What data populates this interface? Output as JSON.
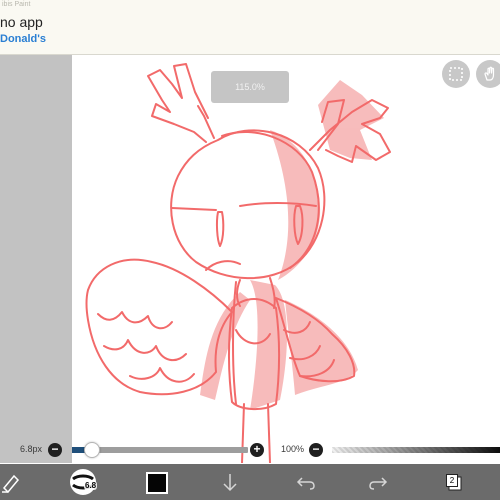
{
  "notification": {
    "meta": "ibis Paint",
    "title": "no app",
    "subtitle": "Donald's"
  },
  "canvas": {
    "zoom_label": "115.0%",
    "stroke_color": "#f26a6a",
    "fill_color": "#f7b8b8"
  },
  "brush": {
    "size_label": "6.8px",
    "size_fraction": 0.08,
    "opacity_label": "100%",
    "minus_label": "−",
    "plus_label": "+"
  },
  "toolbar": {
    "brush_badge": "6.8",
    "current_color": "#050505",
    "layer_count": "2"
  },
  "icons": {
    "selection": "dashed-square-icon",
    "hand": "hand-gesture-icon",
    "tool": "eraser-pen-icon",
    "download": "arrow-down-icon",
    "undo": "undo-icon",
    "redo": "redo-icon",
    "layers": "layers-icon"
  }
}
